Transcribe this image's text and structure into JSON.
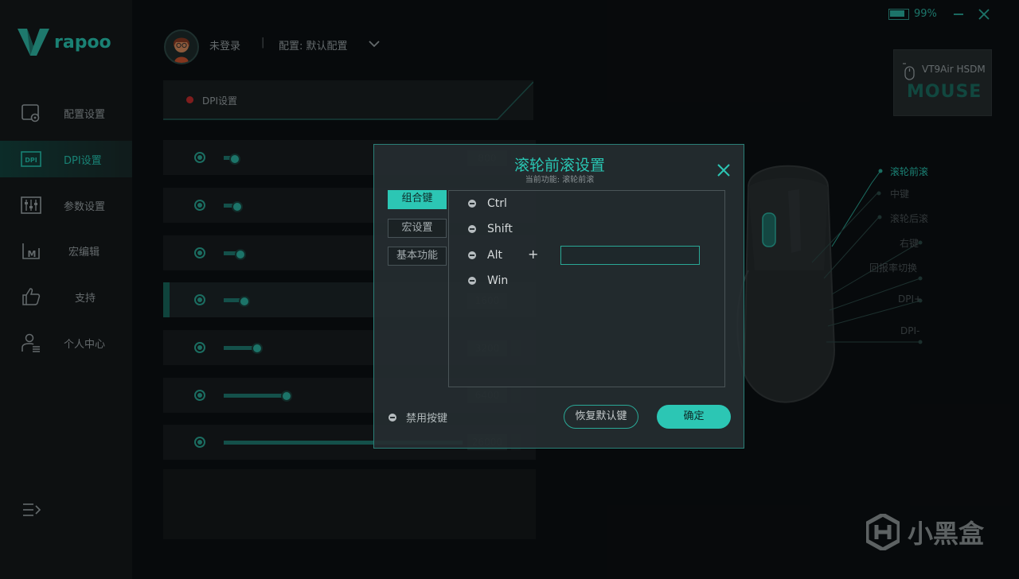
{
  "app": {
    "brand": "rapoo",
    "battery_pct": "99%"
  },
  "sidebar": {
    "items": [
      {
        "label": "配置设置",
        "icon": "config-icon"
      },
      {
        "label": "DPI设置",
        "icon": "dpi-icon"
      },
      {
        "label": "参数设置",
        "icon": "params-icon"
      },
      {
        "label": "宏编辑",
        "icon": "macro-icon"
      },
      {
        "label": "支持",
        "icon": "thumbs-up-icon"
      },
      {
        "label": "个人中心",
        "icon": "user-icon"
      }
    ],
    "active_index": 1
  },
  "topbar": {
    "user_status": "未登录",
    "separator": "|",
    "config": "配置: 默认配置"
  },
  "dpi_panel": {
    "title": "DPI设置",
    "rows": [
      {
        "value": "800"
      },
      {
        "value": ""
      },
      {
        "value": ""
      },
      {
        "value": "1600"
      },
      {
        "value": "3200"
      },
      {
        "value": "6400"
      },
      {
        "value": "26000"
      }
    ]
  },
  "device": {
    "name": "VT9Air HSDM",
    "type": "MOUSE"
  },
  "callouts": [
    "滚轮前滚",
    "中键",
    "滚轮后滚",
    "右键",
    "回报率切换",
    "DPI+",
    "DPI-"
  ],
  "modal": {
    "title": "滚轮前滚设置",
    "subtitle": "当前功能: 滚轮前滚",
    "tabs": [
      "组合键",
      "宏设置",
      "基本功能"
    ],
    "keys": [
      "Ctrl",
      "Shift",
      "Alt",
      "Win"
    ],
    "plus": "+",
    "key_input_value": "",
    "disable_label": "禁用按键",
    "restore_label": "恢复默认键",
    "ok_label": "确定"
  },
  "watermark": "小黑盒",
  "colors": {
    "accent": "#2cc6b4",
    "background": "#0c1013",
    "sidebar": "#15191b",
    "record_dot": "#c42d2d"
  }
}
